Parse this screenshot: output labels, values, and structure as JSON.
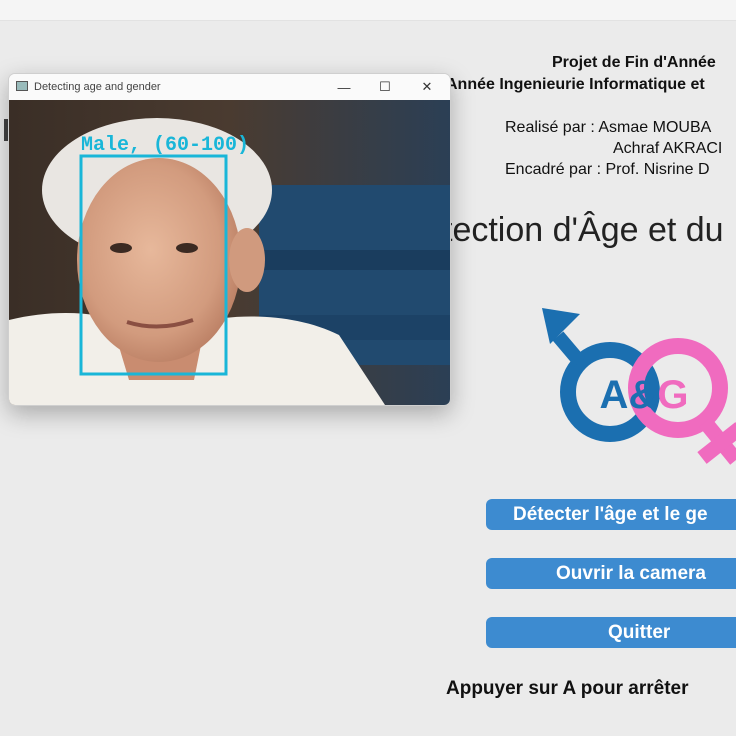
{
  "window": {
    "title": "Detecting age and gender",
    "controls": {
      "minimize": "—",
      "maximize": "☐",
      "close": "✕"
    },
    "detection": {
      "label": "Male, (60-100)",
      "box_color": "#19b6d8"
    }
  },
  "header": {
    "project": "Projet de Fin d'Année",
    "year_line": "Année Ingenieurie Informatique et",
    "realise": "Realisé par : Asmae MOUBA",
    "author2": "Achraf AKRACI",
    "encadre": "Encadré par : Prof. Nisrine D"
  },
  "main": {
    "title": "tection d'Âge et du"
  },
  "logo": {
    "text": "A&G",
    "male_color": "#1b6fb0",
    "female_color": "#f06bbf"
  },
  "buttons": {
    "detect": "Détecter l'âge et le ge",
    "camera": "Ouvrir la camera",
    "quit": "Quitter"
  },
  "hint": "Appuyer sur A pour arrêter",
  "colors": {
    "button_bg": "#3d8bd0",
    "background": "#ebebeb"
  }
}
